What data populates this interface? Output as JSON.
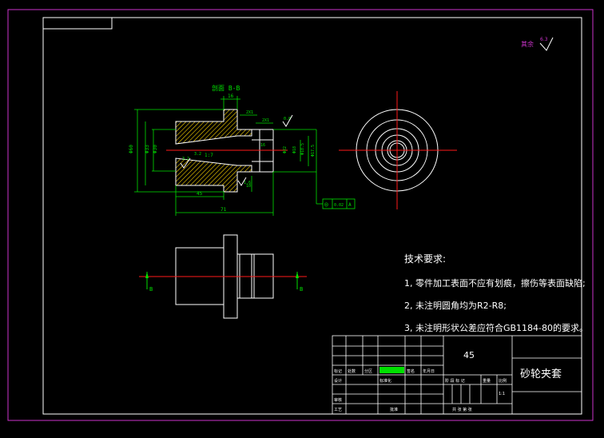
{
  "section_label": "剖面 B-B",
  "section_marker": "B",
  "surface_note": {
    "label": "其余",
    "value": "6.3"
  },
  "roughness_values": [
    "0.8",
    "3.2",
    "3.2",
    "1.6"
  ],
  "dimensions": {
    "top_width": "16",
    "chamfer_1": "2X1",
    "chamfer_2": "2X1",
    "inner_len": "16",
    "d_outer": "Φ60",
    "d_mid": "Φ33",
    "d_bore": "Φ30",
    "d_small1": "Φ22",
    "d_small2": "Φ18",
    "d_small3": "Φ18.5",
    "d_spindle": "Φ17.5",
    "len_45": "45",
    "len_71": "71",
    "len_10": "10",
    "taper": "1:7"
  },
  "tolerance_frame": {
    "symbol": "◎",
    "value": "0.02",
    "datum": "A"
  },
  "tech_req": {
    "title": "技术要求:",
    "items": [
      "1, 零件加工表面不应有划痕，擦伤等表面缺陷;",
      "2, 未注明圆角均为R2-R8;",
      "3, 未注明形状公差应符合GB1184-80的要求。"
    ]
  },
  "title_block": {
    "material": "45",
    "part_name": "砂轮夹套",
    "labels": {
      "mark": "标记",
      "count": "处数",
      "zone": "分区",
      "doc": "更改文件号",
      "sign": "签名",
      "date": "年月日",
      "design": "设计",
      "standard": "标准化",
      "check": "审核",
      "process": "工艺",
      "approve": "批准",
      "stage": "阶 段 标 记",
      "weight": "重量",
      "scale_lbl": "比例",
      "scale": "1:1",
      "sheets": "共   张   第   张"
    }
  },
  "colors": {
    "frame": "#cc33cc",
    "lines": "#ffffff",
    "dims": "#00e000",
    "center": "#ff1a1a",
    "hatch": "#ffd700"
  }
}
